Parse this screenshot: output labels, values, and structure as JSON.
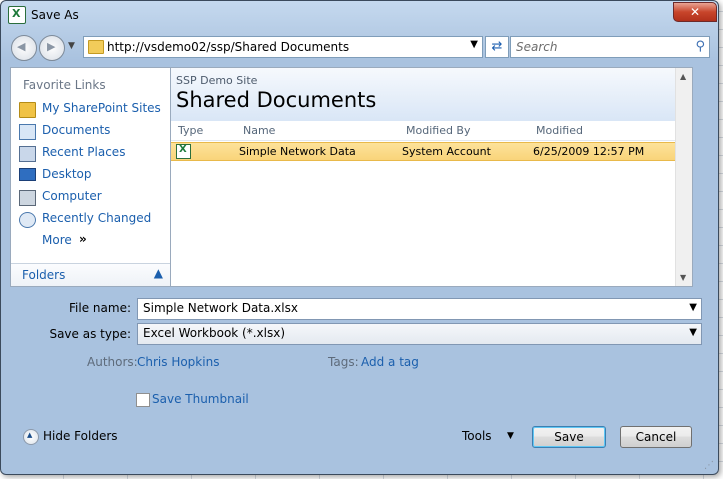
{
  "window": {
    "title": "Save As",
    "close_label": "✕"
  },
  "navigation": {
    "address": "http://vsdemo02/ssp/Shared Documents",
    "search_placeholder": "Search"
  },
  "favorites": {
    "title": "Favorite Links",
    "items": [
      {
        "label": "My SharePoint Sites",
        "icon": "sharepoint-sites-icon"
      },
      {
        "label": "Documents",
        "icon": "documents-icon"
      },
      {
        "label": "Recent Places",
        "icon": "recent-places-icon"
      },
      {
        "label": "Desktop",
        "icon": "desktop-icon"
      },
      {
        "label": "Computer",
        "icon": "computer-icon"
      },
      {
        "label": "Recently Changed",
        "icon": "recently-changed-icon"
      }
    ],
    "more_label": "More",
    "more_chevron": "»",
    "folders_label": "Folders"
  },
  "library": {
    "site_name": "SSP Demo Site",
    "name": "Shared Documents",
    "columns": [
      "Type",
      "Name",
      "Modified By",
      "Modified"
    ],
    "rows": [
      {
        "name": "Simple Network Data",
        "modified_by": "System Account",
        "modified": "6/25/2009 12:57 PM"
      }
    ]
  },
  "form": {
    "file_name_label": "File name:",
    "file_name_value": "Simple Network Data.xlsx",
    "save_type_label": "Save as type:",
    "save_type_value": "Excel Workbook (*.xlsx)",
    "authors_label": "Authors:",
    "authors_value": "Chris Hopkins",
    "tags_label": "Tags:",
    "tags_value": "Add a tag",
    "thumbnail_label": "Save Thumbnail"
  },
  "footer": {
    "hide_folders_label": "Hide Folders",
    "tools_label": "Tools",
    "save_label": "Save",
    "cancel_label": "Cancel"
  },
  "colors": {
    "accent_link": "#1b5fad",
    "selection": "#fde29a",
    "title_bar": "#b7cde6"
  }
}
